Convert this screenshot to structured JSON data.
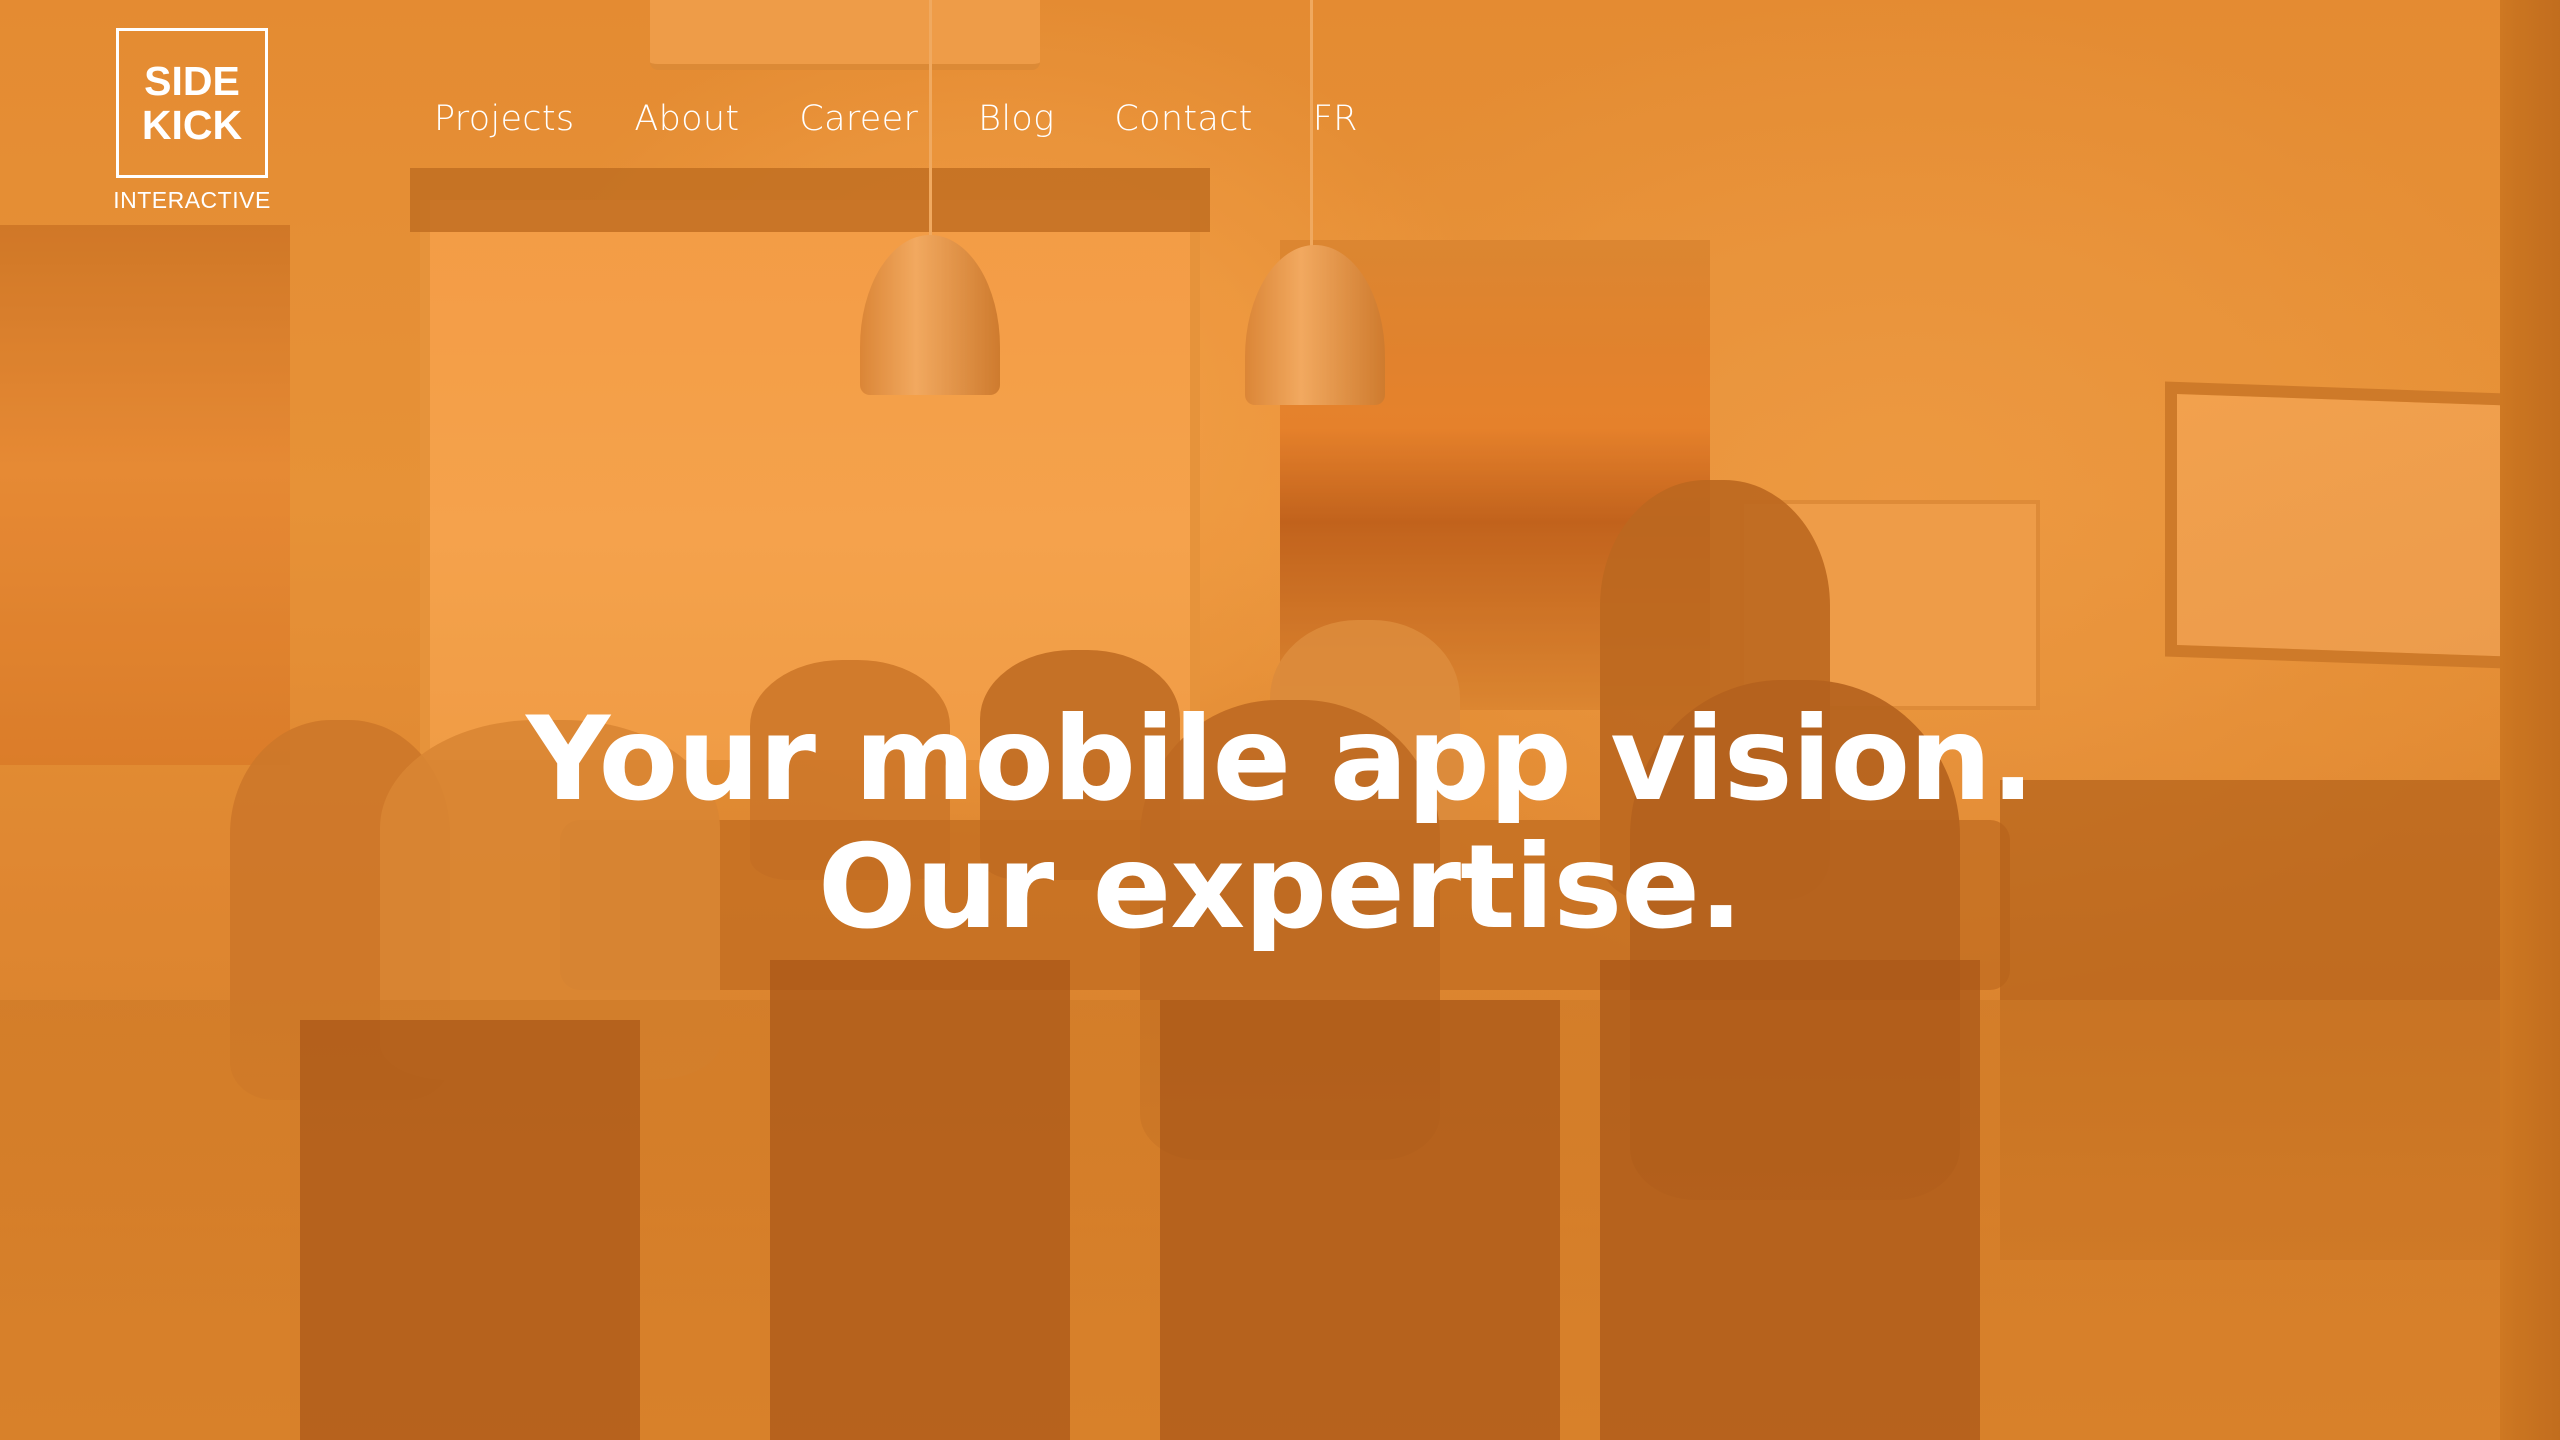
{
  "logo": {
    "line1": "SIDE",
    "line2": "KICK",
    "subtitle": "INTERACTIVE"
  },
  "nav": {
    "items": [
      {
        "label": "Projects"
      },
      {
        "label": "About"
      },
      {
        "label": "Career"
      },
      {
        "label": "Blog"
      },
      {
        "label": "Contact"
      },
      {
        "label": "FR"
      }
    ]
  },
  "hero": {
    "headline_line1": "Your mobile app vision.",
    "headline_line2": "Our expertise.",
    "background_description": "team meeting photo with orange duotone overlay",
    "overlay_color": "#E38B32"
  }
}
